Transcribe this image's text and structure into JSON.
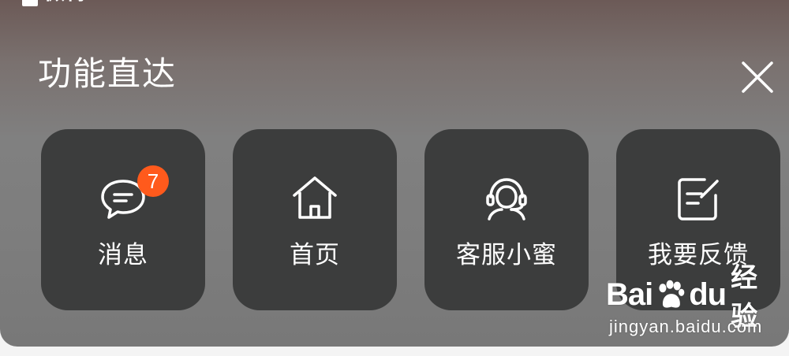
{
  "status_fragment": {
    "text": "微博"
  },
  "panel": {
    "title": "功能直达"
  },
  "tiles": [
    {
      "label": "消息",
      "icon": "message-bubble-icon",
      "badge": "7"
    },
    {
      "label": "首页",
      "icon": "home-icon"
    },
    {
      "label": "客服小蜜",
      "icon": "customer-service-headset-icon"
    },
    {
      "label": "我要反馈",
      "icon": "feedback-edit-icon"
    }
  ],
  "watermark": {
    "brand_latin": "Bai",
    "brand_latin2": "du",
    "brand_cn": "经验",
    "url": "jingyan.baidu.com"
  },
  "colors": {
    "tile_bg": "#3c3d3d",
    "badge": "#ff5a1c",
    "text": "#ffffff"
  }
}
